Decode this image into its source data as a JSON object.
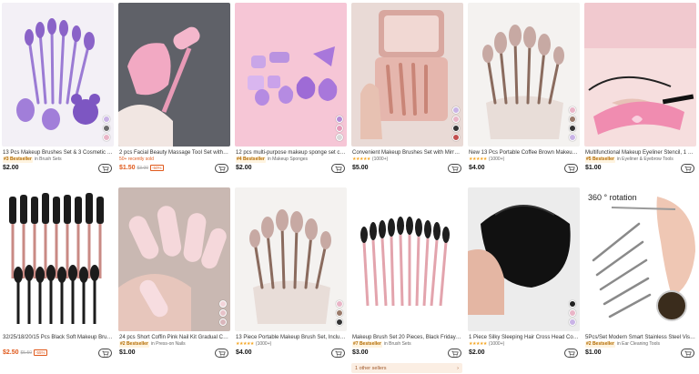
{
  "products": [
    {
      "title": "13 Pcs Makeup Brushes Set & 3 Cosmetic Mak...",
      "badge": "#3 Bestseller",
      "meta": "in Brush Sets",
      "price": "$2.00",
      "swatches": [
        "#c9b3e6",
        "#6c6c6c",
        "#e9b5c7"
      ]
    },
    {
      "title": "2 pcs Facial Beauty Massage Tool Set with Ma...",
      "meta": "50+ recently sold",
      "price": "$1.50",
      "sale": true,
      "orig": "$3.00",
      "tag": "-50%"
    },
    {
      "title": "12 pcs multi-purpose makeup sponge set cons...",
      "badge": "#4 Bestseller",
      "meta": "in Makeup Sponges",
      "price": "$2.00",
      "swatches": [
        "#b48ad6",
        "#e59ab9",
        "#d9d9d9"
      ]
    },
    {
      "title": "Convenient Makeup Brushes Set with Mirror, In...",
      "stars": "★★★★★",
      "meta": "(1000+)",
      "price": "$5.00",
      "swatches": [
        "#c9b3e6",
        "#e9b5c7",
        "#333333",
        "#c24f4f"
      ]
    },
    {
      "title": "New 13 Pcs Portable Coffee Brown Makeup Br...",
      "stars": "★★★★★",
      "meta": "(1000+)",
      "price": "$4.00",
      "swatches": [
        "#e9b5c7",
        "#9a7a6a",
        "#333333",
        "#c9b3e6"
      ]
    },
    {
      "title": "Multifunctional Makeup Eyeliner Stencil, 1 Piec...",
      "badge": "#5 Bestseller",
      "meta": "in Eyeliner & Eyebrow Tools",
      "price": "$1.00"
    },
    {
      "title": "32/25/18/20/15 Pcs Black Soft Makeup Brushe...",
      "meta": "",
      "price": "$2.50",
      "sale": true,
      "orig": "$5.50",
      "tag": "-55%"
    },
    {
      "title": "24 pcs Short Coffin Pink Nail Kit Gradual Char...",
      "badge": "#2 Bestseller",
      "meta": "in Press-on Nails",
      "price": "$1.00",
      "swatches": [
        "#f2d4d9",
        "#e6c2c8",
        "#d9b6bb"
      ]
    },
    {
      "title": "13 Piece Portable Makeup Brush Set, Including...",
      "stars": "★★★★★",
      "meta": "(1000+)",
      "price": "$4.00",
      "swatches": [
        "#e9b5c7",
        "#9a7a6a",
        "#333333"
      ]
    },
    {
      "title": "Makeup Brush Set 20 Pieces, Black Friday Cos...",
      "badge": "#7 Bestseller",
      "meta": "in Brush Sets",
      "price": "$3.00"
    },
    {
      "title": "1 Piece Silky Sleeping Hair Cross Head Cover ...",
      "stars": "★★★★★",
      "meta": "(1000+)",
      "price": "$2.00",
      "swatches": [
        "#222222",
        "#e9b5c7",
        "#c9b3e6"
      ]
    },
    {
      "title": "5Pcs/Set Modern Smart Stainless Steel Visual ...",
      "badge": "#2 Bestseller",
      "meta": "in Ear Cleaning Tools",
      "price": "$1.00"
    }
  ],
  "rotation_label": "360 ° rotation",
  "other_sellers": "1 other sellers",
  "other_sellers_arrow": "›"
}
